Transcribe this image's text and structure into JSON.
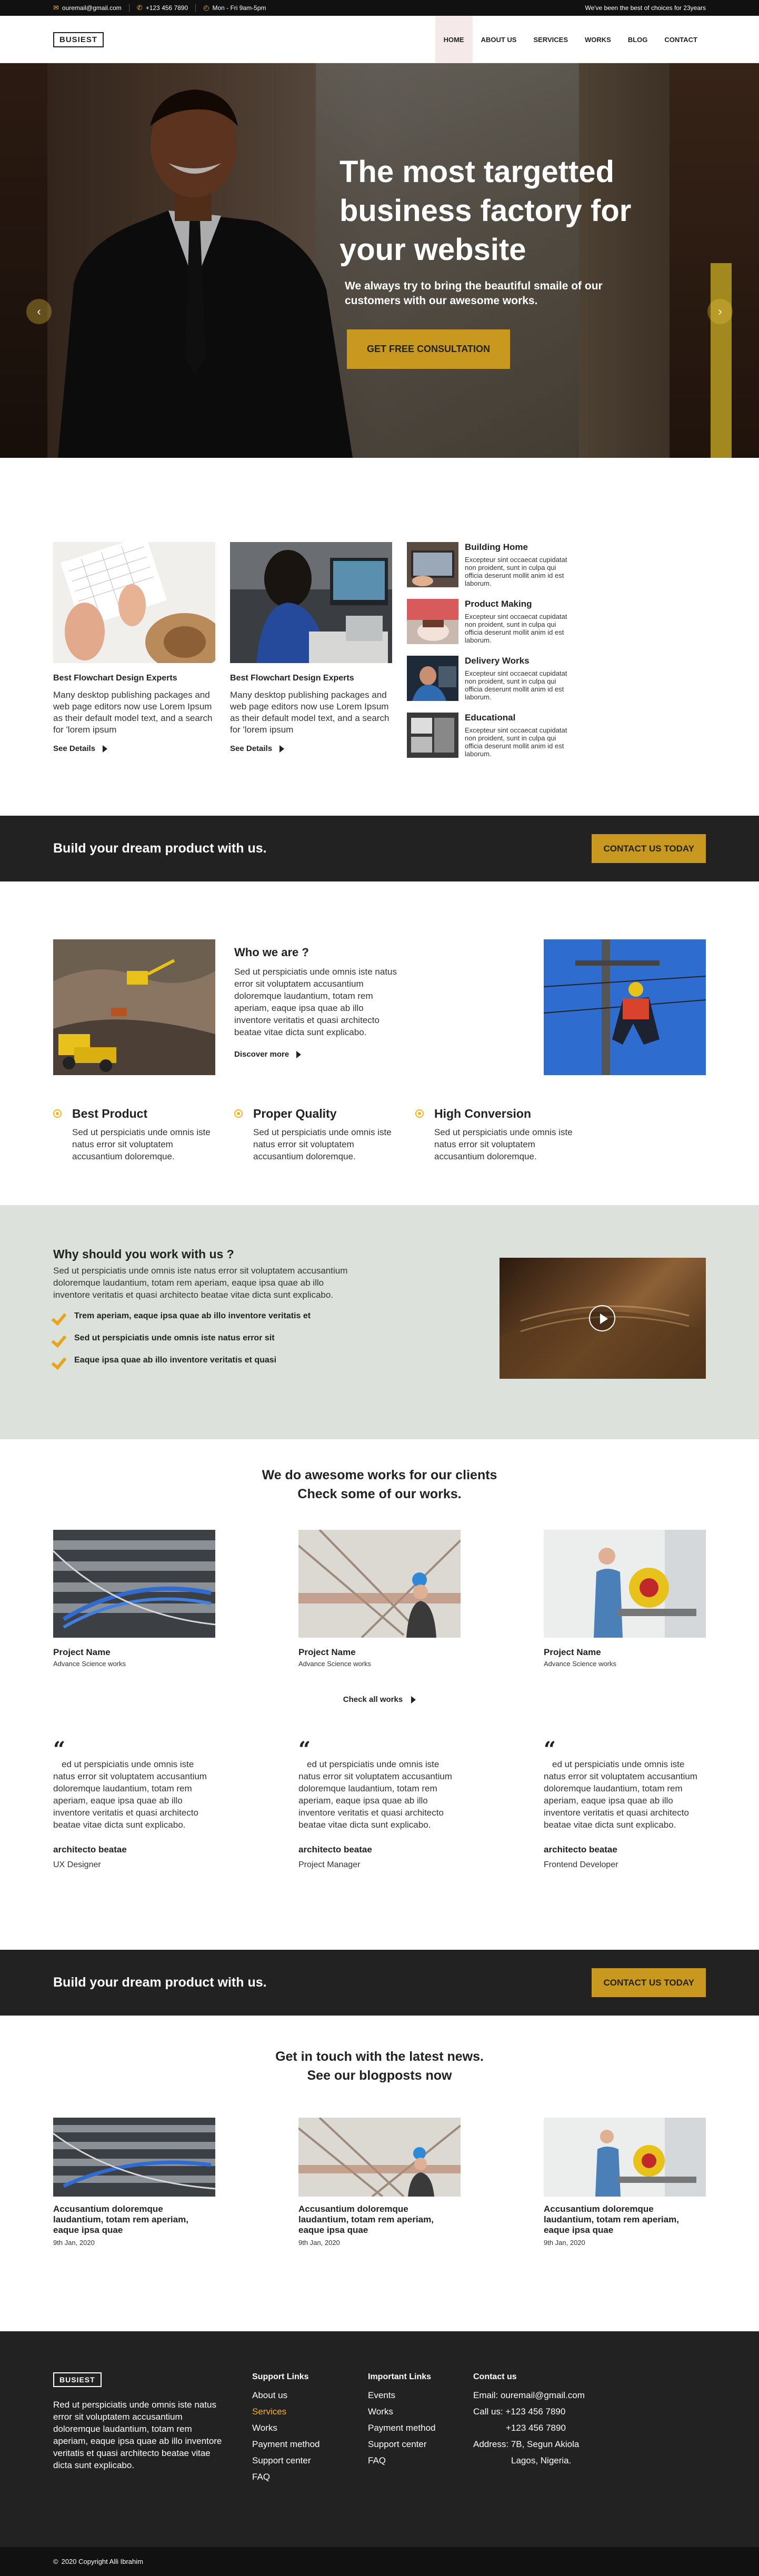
{
  "topbar": {
    "email": "ouremail@gmail.com",
    "phone": "+123 456 7890",
    "hours": "Mon - Fri 9am-5pm",
    "tagline": "We've been the best of choices for 23years"
  },
  "brand": {
    "logo": "BUSIEST"
  },
  "nav": [
    {
      "label": "HOME",
      "active": true
    },
    {
      "label": "ABOUT US"
    },
    {
      "label": "SERVICES"
    },
    {
      "label": "WORKS"
    },
    {
      "label": "BLOG"
    },
    {
      "label": "CONTACT"
    }
  ],
  "hero": {
    "title": "The most targetted business factory for your website",
    "subtitle": "We always try to bring the beautiful smaile of our customers with our awesome works.",
    "cta": "GET FREE CONSULTATION"
  },
  "services": {
    "cards": [
      {
        "title": "Best Flowchart Design Experts",
        "text": "Many desktop publishing packages and web page editors now use Lorem Ipsum as their default model text, and a search for 'lorem ipsum",
        "more": "See Details"
      },
      {
        "title": "Best Flowchart Design Experts",
        "text": "Many desktop publishing packages and web page editors now use Lorem Ipsum as their default model text, and a search for 'lorem ipsum",
        "more": "See Details"
      }
    ],
    "list": [
      {
        "title": "Building Home",
        "text": "Excepteur sint occaecat cupidatat non proident, sunt in culpa qui officia deserunt mollit anim id est laborum."
      },
      {
        "title": "Product Making",
        "text": "Excepteur sint occaecat cupidatat non proident, sunt in culpa qui officia deserunt mollit anim id est laborum."
      },
      {
        "title": "Delivery Works",
        "text": "Excepteur sint occaecat cupidatat non proident, sunt in culpa qui officia deserunt mollit anim id est laborum."
      },
      {
        "title": "Educational",
        "text": "Excepteur sint occaecat cupidatat non proident, sunt in culpa qui officia deserunt mollit anim id est laborum."
      }
    ]
  },
  "cta1": {
    "title": "Build your dream product with us.",
    "button": "CONTACT US TODAY"
  },
  "about": {
    "title": "Who we are ?",
    "text": "Sed ut perspiciatis unde omnis iste natus error sit voluptatem accusantium doloremque laudantium, totam rem aperiam, eaque ipsa quae ab illo inventore veritatis et quasi architecto beatae vitae dicta sunt explicabo.",
    "more": "Discover more",
    "features": [
      {
        "title": "Best Product",
        "text": "Sed ut perspiciatis unde omnis iste natus error sit voluptatem accusantium doloremque."
      },
      {
        "title": "Proper Quality",
        "text": "Sed ut perspiciatis unde omnis iste natus error sit voluptatem accusantium doloremque."
      },
      {
        "title": "High Conversion",
        "text": "Sed ut perspiciatis unde omnis iste natus error sit voluptatem accusantium doloremque."
      }
    ]
  },
  "why": {
    "title": "Why should you work with us ?",
    "text": "Sed ut perspiciatis unde omnis iste natus error sit voluptatem accusantium doloremque laudantium, totam rem aperiam, eaque ipsa quae ab illo inventore veritatis et quasi architecto beatae vitae dicta sunt explicabo.",
    "checks": [
      "Trem aperiam, eaque ipsa quae ab illo inventore veritatis et",
      "Sed ut perspiciatis unde omnis iste natus error sit",
      "Eaque ipsa quae ab illo inventore veritatis et quasi"
    ]
  },
  "works": {
    "title_line1": "We do awesome works for our clients",
    "title_line2": "Check some of our works.",
    "items": [
      {
        "name": "Project Name",
        "sub": "Advance Science works"
      },
      {
        "name": "Project Name",
        "sub": "Advance Science works"
      },
      {
        "name": "Project Name",
        "sub": "Advance Science works"
      }
    ],
    "checkall": "Check all works"
  },
  "testimonials": [
    {
      "quote_mark": "“",
      "text": "ed ut perspiciatis unde omnis iste natus error sit voluptatem accusantium doloremque laudantium, totam rem aperiam, eaque ipsa quae ab illo inventore veritatis et quasi architecto beatae vitae dicta sunt explicabo.",
      "name": "architecto beatae",
      "role": "UX Designer"
    },
    {
      "quote_mark": "“",
      "text": "ed ut perspiciatis unde omnis iste natus error sit voluptatem accusantium doloremque laudantium, totam rem aperiam, eaque ipsa quae ab illo inventore veritatis et quasi architecto beatae vitae dicta sunt explicabo.",
      "name": "architecto beatae",
      "role": "Project Manager"
    },
    {
      "quote_mark": "“",
      "text": "ed ut perspiciatis unde omnis iste natus error sit voluptatem accusantium doloremque laudantium, totam rem aperiam, eaque ipsa quae ab illo inventore veritatis et quasi architecto beatae vitae dicta sunt explicabo.",
      "name": "architecto beatae",
      "role": "Frontend Developer"
    }
  ],
  "cta2": {
    "title": "Build your dream product with us.",
    "button": "CONTACT US TODAY"
  },
  "news": {
    "title_line1": "Get in touch with the latest news.",
    "title_line2": "See our blogposts now",
    "posts": [
      {
        "title": "Accusantium doloremque laudantium, totam rem aperiam, eaque ipsa quae",
        "date": "9th Jan, 2020"
      },
      {
        "title": "Accusantium doloremque laudantium, totam rem aperiam, eaque ipsa quae",
        "date": "9th Jan, 2020"
      },
      {
        "title": "Accusantium doloremque laudantium, totam rem aperiam, eaque ipsa quae",
        "date": "9th Jan, 2020"
      }
    ]
  },
  "footer": {
    "logo": "BUSIEST",
    "about": "Red ut perspiciatis unde omnis iste natus error sit voluptatem accusantium doloremque laudantium, totam rem aperiam, eaque ipsa quae ab illo inventore veritatis et quasi architecto beatae vitae dicta sunt explicabo.",
    "support": {
      "title": "Support Links",
      "items": [
        "About us",
        "Services",
        "Works",
        "Payment method",
        "Support center",
        "FAQ"
      ]
    },
    "important": {
      "title": "Important Links",
      "items": [
        "Events",
        "Works",
        "Payment method",
        "Support center",
        "FAQ"
      ]
    },
    "contact": {
      "title": "Contact us",
      "email": "Email: ouremail@gmail.com",
      "call": "Call us: +123 456 7890",
      "call2": "+123 456 7890",
      "address": "Address:  7B, Segun Akiola",
      "address2": "Lagos, Nigeria."
    },
    "copyright": "2020 Copyright Alli Ibrahim",
    "copy_icon": "©"
  },
  "colors": {
    "accent": "#c9981f",
    "icon_yellow": "#f5b31b",
    "dark": "#222222",
    "why_bg": "#dce1db"
  }
}
